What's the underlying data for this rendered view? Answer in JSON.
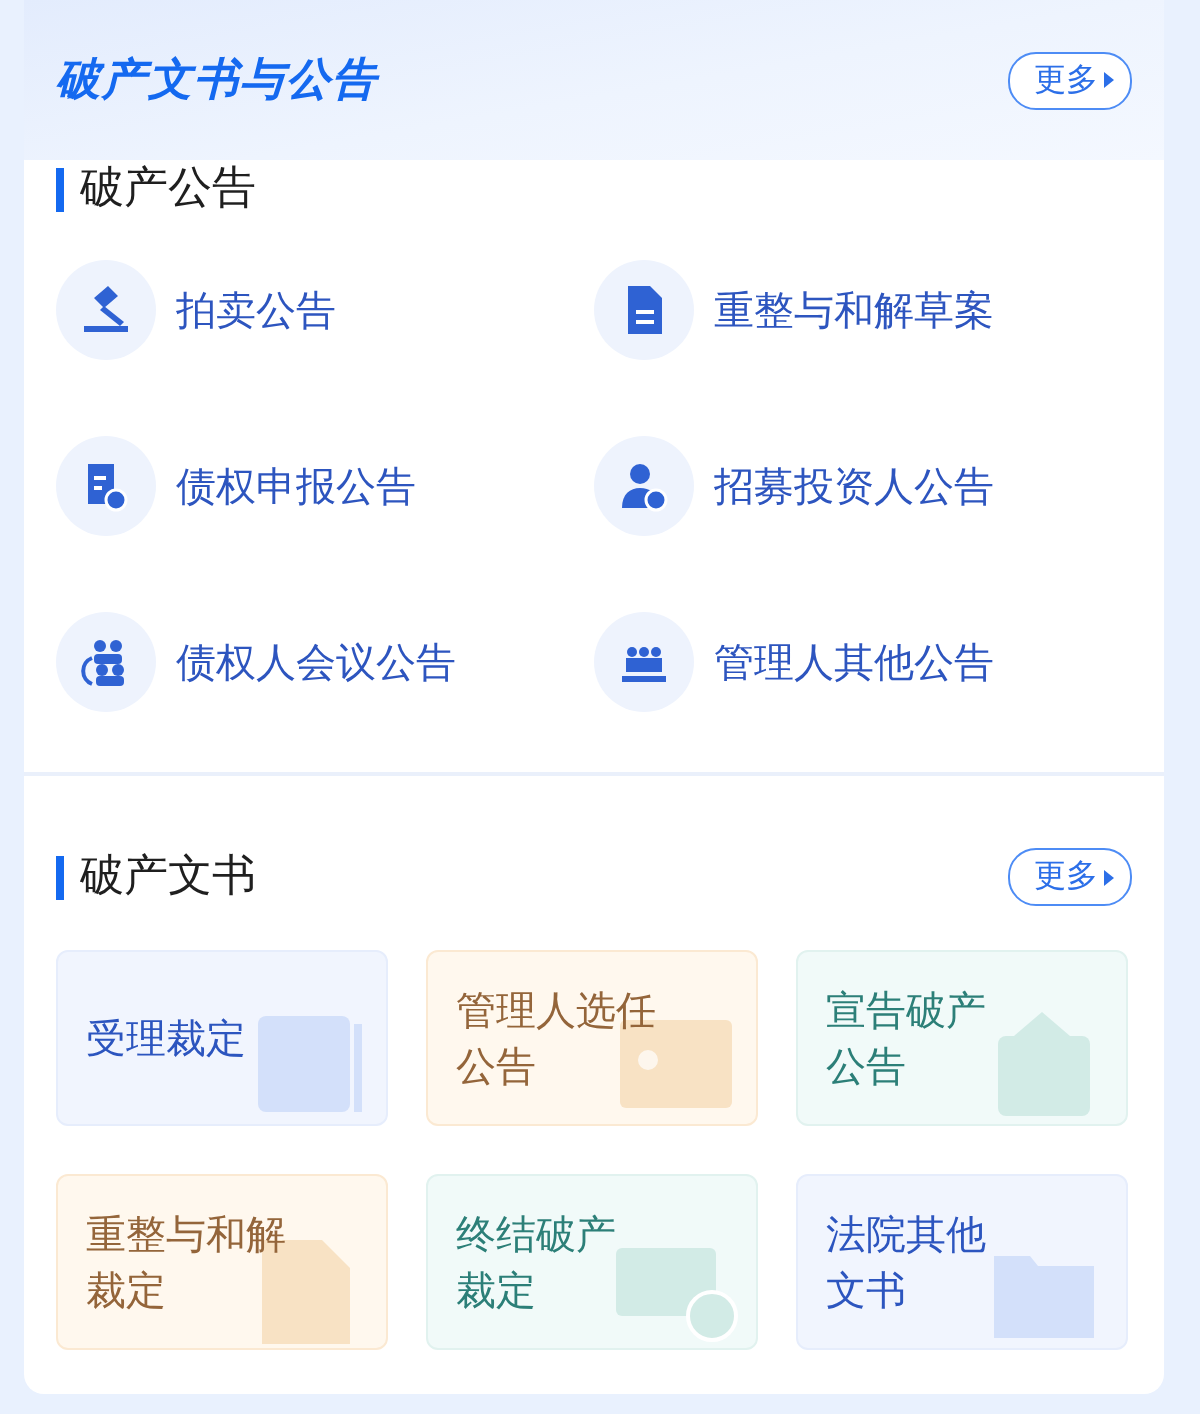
{
  "panel": {
    "title": "破产文书与公告",
    "more": "更多"
  },
  "notices": {
    "heading": "破产公告",
    "items": [
      {
        "label": "拍卖公告"
      },
      {
        "label": "重整与和解草案"
      },
      {
        "label": "债权申报公告"
      },
      {
        "label": "招募投资人公告"
      },
      {
        "label": "债权人会议公告"
      },
      {
        "label": "管理人其他公告"
      }
    ]
  },
  "documents": {
    "heading": "破产文书",
    "more": "更多",
    "tiles": [
      {
        "label": "受理裁定",
        "kind": "blue"
      },
      {
        "label": "管理人选任公告",
        "kind": "orange"
      },
      {
        "label": "宣告破产公告",
        "kind": "green"
      },
      {
        "label": "重整与和解裁定",
        "kind": "orange"
      },
      {
        "label": "终结破产裁定",
        "kind": "green"
      },
      {
        "label": "法院其他文书",
        "kind": "blue"
      }
    ]
  }
}
